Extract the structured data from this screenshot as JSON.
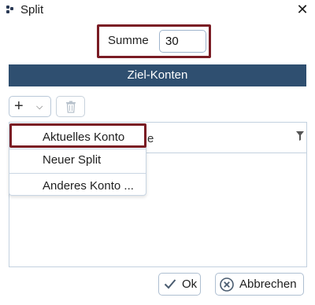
{
  "window": {
    "title": "Split",
    "close_glyph": "✕"
  },
  "summe": {
    "label": "Summe",
    "value": "30"
  },
  "section": {
    "title": "Ziel-Konten"
  },
  "toolbar": {
    "add_glyph": "+",
    "chevron_glyph": "⌵"
  },
  "grid": {
    "column_partial": "e"
  },
  "menu": {
    "items": [
      "Aktuelles Konto",
      "Neuer Split",
      "Anderes Konto ..."
    ]
  },
  "buttons": {
    "ok": "Ok",
    "cancel": "Abbrechen"
  },
  "colors": {
    "header": "#2f4f70",
    "highlight": "#7a1c24"
  }
}
